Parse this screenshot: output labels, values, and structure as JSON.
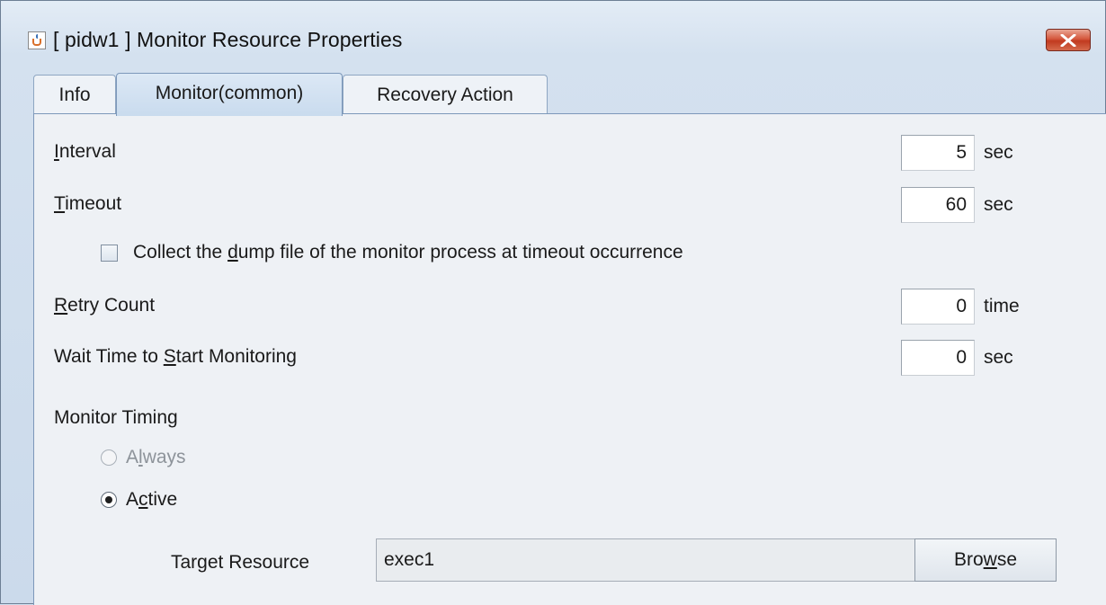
{
  "window": {
    "title": "[ pidw1 ] Monitor Resource Properties"
  },
  "tabs": [
    {
      "label": "Info",
      "active": false
    },
    {
      "label": "Monitor(common)",
      "active": true
    },
    {
      "label": "Recovery Action",
      "active": false
    }
  ],
  "fields": {
    "interval": {
      "label_pre": "",
      "mnemonic": "I",
      "label_post": "nterval",
      "value": "5",
      "unit": "sec"
    },
    "timeout": {
      "label_pre": "",
      "mnemonic": "T",
      "label_post": "imeout",
      "value": "60",
      "unit": "sec"
    },
    "retry": {
      "label_pre": "",
      "mnemonic": "R",
      "label_post": "etry Count",
      "value": "0",
      "unit": "time"
    },
    "wait": {
      "label_pre": "Wait Time to ",
      "mnemonic": "S",
      "label_post": "tart Monitoring",
      "value": "0",
      "unit": "sec"
    }
  },
  "dump_checkbox": {
    "label_pre": "Collect the ",
    "mnemonic": "d",
    "label_post": "ump file of the monitor process at timeout occurrence",
    "checked": false
  },
  "monitor_timing": {
    "heading": "Monitor Timing",
    "always": {
      "label_pre": "A",
      "mnemonic": "l",
      "label_post": "ways",
      "selected": false,
      "enabled": false
    },
    "active": {
      "label_pre": "A",
      "mnemonic": "c",
      "label_post": "tive",
      "selected": true,
      "enabled": true
    }
  },
  "target_resource": {
    "label": "Target Resource",
    "value": "exec1",
    "browse_pre": "Bro",
    "browse_mnemonic": "w",
    "browse_post": "se"
  },
  "colors": {
    "accent": "#7d98ba",
    "close_button": "#c13a1f",
    "panel_bg": "#eef1f5"
  },
  "icons": {
    "app": "java-cup-icon",
    "close": "close-x-icon"
  }
}
